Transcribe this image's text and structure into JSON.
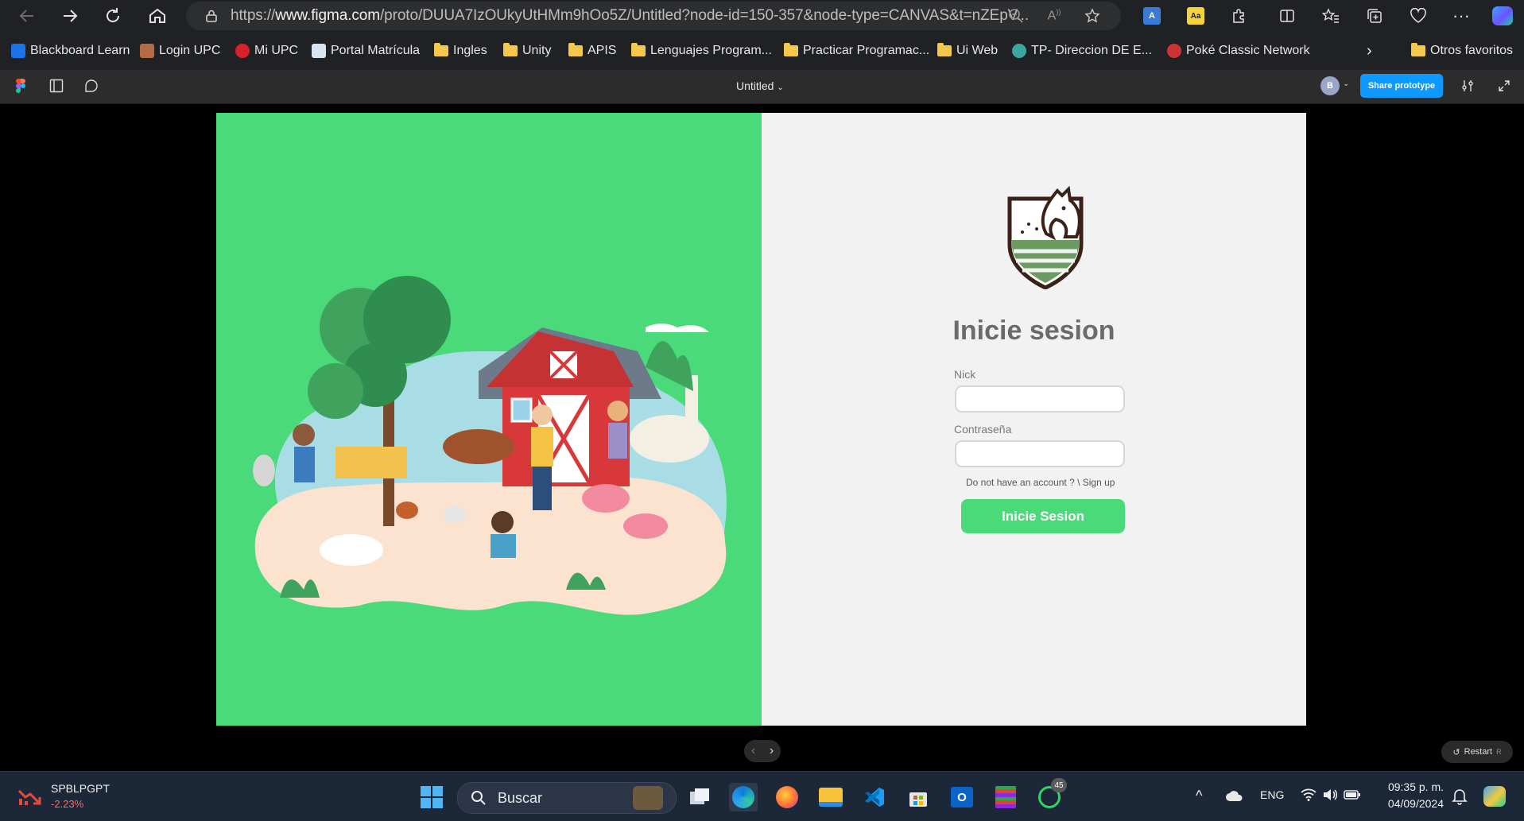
{
  "browser": {
    "url_prefix": "https://",
    "url_host": "www.figma.com",
    "url_path": "/proto/DUUA7IzOUkyUtHMm9hOo5Z/Untitled?node-id=150-357&node-type=CANVAS&t=nZEpV...",
    "bookmarks": [
      {
        "label": "Blackboard Learn"
      },
      {
        "label": "Login UPC"
      },
      {
        "label": "Mi UPC"
      },
      {
        "label": "Portal Matrícula"
      },
      {
        "label": "Ingles"
      },
      {
        "label": "Unity"
      },
      {
        "label": "APIS"
      },
      {
        "label": "Lenguajes Program..."
      },
      {
        "label": "Practicar Programac..."
      },
      {
        "label": "Ui Web"
      },
      {
        "label": "TP- Direccion DE E..."
      },
      {
        "label": "Poké Classic Network"
      }
    ],
    "other_favorites": "Otros favoritos"
  },
  "figma": {
    "file_title": "Untitled",
    "avatar_initial": "B",
    "share_label": "Share prototype",
    "restart_label": "Restart",
    "restart_shortcut": "R"
  },
  "login": {
    "title": "Inicie sesion",
    "nick_label": "Nick",
    "nick_value": "",
    "password_label": "Contraseña",
    "password_value": "",
    "signup_text": "Do not have an account ? \\ Sign up",
    "submit_label": "Inicie Sesion"
  },
  "colors": {
    "accent_green": "#4ada7a",
    "panel_bg": "#f2f2f2",
    "title_gray": "#6b6b6b",
    "figma_blue": "#0d99ff"
  },
  "taskbar": {
    "stock_symbol": "SPBLPGPT",
    "stock_change": "-2.23%",
    "search_placeholder": "Buscar",
    "whatsapp_badge": "45",
    "language": "ENG",
    "time": "09:35 p. m.",
    "date": "04/09/2024"
  }
}
